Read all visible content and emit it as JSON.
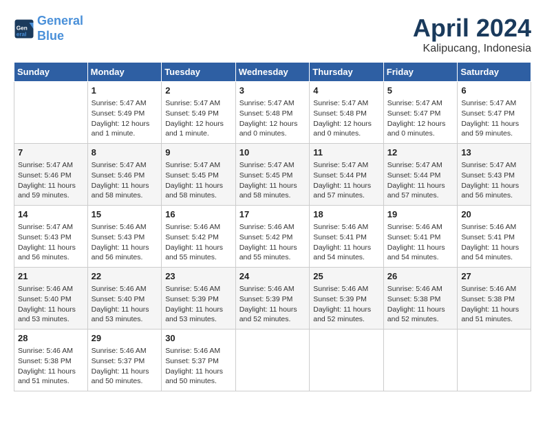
{
  "logo": {
    "line1": "General",
    "line2": "Blue"
  },
  "title": "April 2024",
  "subtitle": "Kalipucang, Indonesia",
  "header_days": [
    "Sunday",
    "Monday",
    "Tuesday",
    "Wednesday",
    "Thursday",
    "Friday",
    "Saturday"
  ],
  "weeks": [
    [
      {
        "day": "",
        "info": ""
      },
      {
        "day": "1",
        "info": "Sunrise: 5:47 AM\nSunset: 5:49 PM\nDaylight: 12 hours\nand 1 minute."
      },
      {
        "day": "2",
        "info": "Sunrise: 5:47 AM\nSunset: 5:49 PM\nDaylight: 12 hours\nand 1 minute."
      },
      {
        "day": "3",
        "info": "Sunrise: 5:47 AM\nSunset: 5:48 PM\nDaylight: 12 hours\nand 0 minutes."
      },
      {
        "day": "4",
        "info": "Sunrise: 5:47 AM\nSunset: 5:48 PM\nDaylight: 12 hours\nand 0 minutes."
      },
      {
        "day": "5",
        "info": "Sunrise: 5:47 AM\nSunset: 5:47 PM\nDaylight: 12 hours\nand 0 minutes."
      },
      {
        "day": "6",
        "info": "Sunrise: 5:47 AM\nSunset: 5:47 PM\nDaylight: 11 hours\nand 59 minutes."
      }
    ],
    [
      {
        "day": "7",
        "info": "Sunrise: 5:47 AM\nSunset: 5:46 PM\nDaylight: 11 hours\nand 59 minutes."
      },
      {
        "day": "8",
        "info": "Sunrise: 5:47 AM\nSunset: 5:46 PM\nDaylight: 11 hours\nand 58 minutes."
      },
      {
        "day": "9",
        "info": "Sunrise: 5:47 AM\nSunset: 5:45 PM\nDaylight: 11 hours\nand 58 minutes."
      },
      {
        "day": "10",
        "info": "Sunrise: 5:47 AM\nSunset: 5:45 PM\nDaylight: 11 hours\nand 58 minutes."
      },
      {
        "day": "11",
        "info": "Sunrise: 5:47 AM\nSunset: 5:44 PM\nDaylight: 11 hours\nand 57 minutes."
      },
      {
        "day": "12",
        "info": "Sunrise: 5:47 AM\nSunset: 5:44 PM\nDaylight: 11 hours\nand 57 minutes."
      },
      {
        "day": "13",
        "info": "Sunrise: 5:47 AM\nSunset: 5:43 PM\nDaylight: 11 hours\nand 56 minutes."
      }
    ],
    [
      {
        "day": "14",
        "info": "Sunrise: 5:47 AM\nSunset: 5:43 PM\nDaylight: 11 hours\nand 56 minutes."
      },
      {
        "day": "15",
        "info": "Sunrise: 5:46 AM\nSunset: 5:43 PM\nDaylight: 11 hours\nand 56 minutes."
      },
      {
        "day": "16",
        "info": "Sunrise: 5:46 AM\nSunset: 5:42 PM\nDaylight: 11 hours\nand 55 minutes."
      },
      {
        "day": "17",
        "info": "Sunrise: 5:46 AM\nSunset: 5:42 PM\nDaylight: 11 hours\nand 55 minutes."
      },
      {
        "day": "18",
        "info": "Sunrise: 5:46 AM\nSunset: 5:41 PM\nDaylight: 11 hours\nand 54 minutes."
      },
      {
        "day": "19",
        "info": "Sunrise: 5:46 AM\nSunset: 5:41 PM\nDaylight: 11 hours\nand 54 minutes."
      },
      {
        "day": "20",
        "info": "Sunrise: 5:46 AM\nSunset: 5:41 PM\nDaylight: 11 hours\nand 54 minutes."
      }
    ],
    [
      {
        "day": "21",
        "info": "Sunrise: 5:46 AM\nSunset: 5:40 PM\nDaylight: 11 hours\nand 53 minutes."
      },
      {
        "day": "22",
        "info": "Sunrise: 5:46 AM\nSunset: 5:40 PM\nDaylight: 11 hours\nand 53 minutes."
      },
      {
        "day": "23",
        "info": "Sunrise: 5:46 AM\nSunset: 5:39 PM\nDaylight: 11 hours\nand 53 minutes."
      },
      {
        "day": "24",
        "info": "Sunrise: 5:46 AM\nSunset: 5:39 PM\nDaylight: 11 hours\nand 52 minutes."
      },
      {
        "day": "25",
        "info": "Sunrise: 5:46 AM\nSunset: 5:39 PM\nDaylight: 11 hours\nand 52 minutes."
      },
      {
        "day": "26",
        "info": "Sunrise: 5:46 AM\nSunset: 5:38 PM\nDaylight: 11 hours\nand 52 minutes."
      },
      {
        "day": "27",
        "info": "Sunrise: 5:46 AM\nSunset: 5:38 PM\nDaylight: 11 hours\nand 51 minutes."
      }
    ],
    [
      {
        "day": "28",
        "info": "Sunrise: 5:46 AM\nSunset: 5:38 PM\nDaylight: 11 hours\nand 51 minutes."
      },
      {
        "day": "29",
        "info": "Sunrise: 5:46 AM\nSunset: 5:37 PM\nDaylight: 11 hours\nand 50 minutes."
      },
      {
        "day": "30",
        "info": "Sunrise: 5:46 AM\nSunset: 5:37 PM\nDaylight: 11 hours\nand 50 minutes."
      },
      {
        "day": "",
        "info": ""
      },
      {
        "day": "",
        "info": ""
      },
      {
        "day": "",
        "info": ""
      },
      {
        "day": "",
        "info": ""
      }
    ]
  ]
}
